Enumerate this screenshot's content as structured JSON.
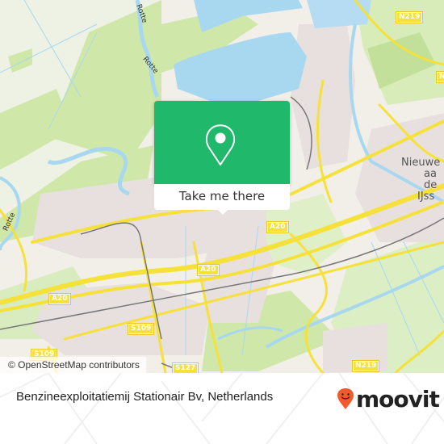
{
  "map": {
    "attribution": "© OpenStreetMap contributors",
    "colors": {
      "land": "#f2efe9",
      "water": "#a8d8f0",
      "green": "#cfe8a9",
      "road_major": "#f5e13a",
      "urban": "#e8e0de",
      "popup": "#20b86a",
      "moovit_orange": "#f15a2b"
    },
    "road_shields": [
      {
        "id": "n219-top",
        "label": "N219"
      },
      {
        "id": "n219-right",
        "label": "N"
      },
      {
        "id": "a20-center",
        "label": "A20"
      },
      {
        "id": "a20-mid",
        "label": "A20"
      },
      {
        "id": "a20-left",
        "label": "A20"
      },
      {
        "id": "s109-center",
        "label": "S109"
      },
      {
        "id": "s109-left",
        "label": "S109"
      },
      {
        "id": "s127",
        "label": "S127"
      },
      {
        "id": "n219-bottom",
        "label": "N219"
      }
    ],
    "place_labels": {
      "town": [
        "Nieuwe",
        "aa",
        "de",
        "IJss"
      ]
    },
    "river_labels": [
      "Rotte",
      "Rotte",
      "Rotte"
    ]
  },
  "popup": {
    "icon": "map-pin-icon",
    "button_label": "Take me there"
  },
  "footer": {
    "address": "Benzineexploitatiemij Stationair Bv, Netherlands",
    "brand": "moovit"
  }
}
